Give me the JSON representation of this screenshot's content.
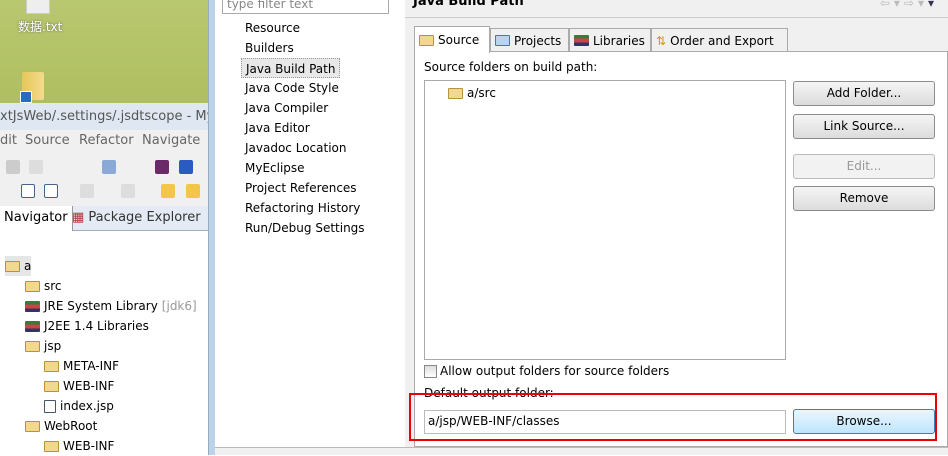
{
  "desktop": {
    "file_label": "数据.txt"
  },
  "eclipse": {
    "title": "xtJsWeb/.settings/.jsdtscope - MyEcl",
    "menu": [
      "dit",
      "Source",
      "Refactor",
      "Navigate"
    ],
    "tabs": [
      "Navigator",
      "Package Explorer"
    ],
    "tree": [
      {
        "label": "a",
        "icon": "project-icon"
      },
      {
        "label": "src",
        "icon": "source-folder-icon"
      },
      {
        "label": "JRE System Library",
        "suffix": "[jdk6]",
        "icon": "library-icon"
      },
      {
        "label": "J2EE 1.4 Libraries",
        "icon": "library-icon"
      },
      {
        "label": "jsp",
        "icon": "folder-icon"
      },
      {
        "label": "META-INF",
        "icon": "folder-icon"
      },
      {
        "label": "WEB-INF",
        "icon": "folder-icon"
      },
      {
        "label": "index.jsp",
        "icon": "jsp-file-icon"
      },
      {
        "label": "WebRoot",
        "icon": "folder-icon"
      },
      {
        "label": "WEB-INF",
        "icon": "folder-icon"
      }
    ]
  },
  "dialog": {
    "filter_placeholder": "type filter text",
    "categories": [
      "Resource",
      "Builders",
      "Java Build Path",
      "Java Code Style",
      "Java Compiler",
      "Java Editor",
      "Javadoc Location",
      "MyEclipse",
      "Project References",
      "Refactoring History",
      "Run/Debug Settings"
    ],
    "selected_category": "Java Build Path",
    "page_title": "Java Build Path",
    "tabs": [
      "Source",
      "Projects",
      "Libraries",
      "Order and Export"
    ],
    "source_label": "Source folders on build path:",
    "source_folders": [
      "a/src"
    ],
    "buttons": {
      "add_folder": "Add Folder...",
      "link_source": "Link Source...",
      "edit": "Edit...",
      "remove": "Remove",
      "browse": "Browse..."
    },
    "allow_output_label": "Allow output folders for source folders",
    "allow_output_checked": false,
    "default_output_label": "Default output folder:",
    "default_output_value": "a/jsp/WEB-INF/classes",
    "highlight_color": "#e00000"
  }
}
